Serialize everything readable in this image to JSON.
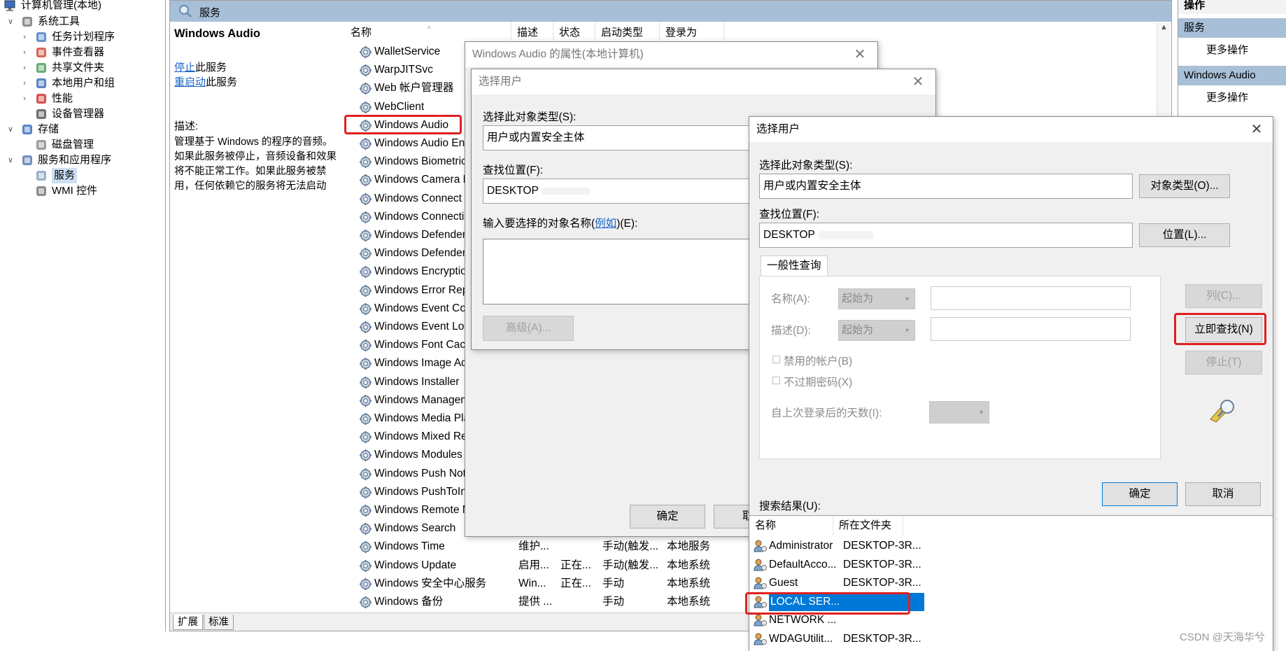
{
  "tree": {
    "root": "计算机管理(本地)",
    "items": [
      {
        "label": "系统工具",
        "level": 1,
        "expanded": true
      },
      {
        "label": "任务计划程序",
        "level": 2
      },
      {
        "label": "事件查看器",
        "level": 2
      },
      {
        "label": "共享文件夹",
        "level": 2
      },
      {
        "label": "本地用户和组",
        "level": 2
      },
      {
        "label": "性能",
        "level": 2
      },
      {
        "label": "设备管理器",
        "level": 2
      },
      {
        "label": "存储",
        "level": 1,
        "expanded": true
      },
      {
        "label": "磁盘管理",
        "level": 2
      },
      {
        "label": "服务和应用程序",
        "level": 1,
        "expanded": true
      },
      {
        "label": "服务",
        "level": 2,
        "selected": true
      },
      {
        "label": "WMI 控件",
        "level": 2
      }
    ]
  },
  "services_header": "服务",
  "description_pane": {
    "title": "Windows Audio",
    "stop_link": "停止",
    "stop_suffix": "此服务",
    "restart_link": "重启动",
    "restart_suffix": "此服务",
    "desc_label": "描述:",
    "desc_lines": [
      "管理基于 Windows 的程序的音频。",
      "如果此服务被停止，音频设备和效果",
      "将不能正常工作。如果此服务被禁",
      "用，任何依赖它的服务将无法启动"
    ]
  },
  "columns": {
    "name": "名称",
    "desc": "描述",
    "status": "状态",
    "startup": "启动类型",
    "logon": "登录为"
  },
  "services": [
    {
      "name": "WalletService"
    },
    {
      "name": "WarpJITSvc"
    },
    {
      "name": "Web 帐户管理器"
    },
    {
      "name": "WebClient"
    },
    {
      "name": "Windows Audio",
      "highlighted": true
    },
    {
      "name": "Windows Audio End"
    },
    {
      "name": "Windows Biometric"
    },
    {
      "name": "Windows Camera F"
    },
    {
      "name": "Windows Connect N"
    },
    {
      "name": "Windows Connectio"
    },
    {
      "name": "Windows Defender"
    },
    {
      "name": "Windows Defender"
    },
    {
      "name": "Windows Encryptio"
    },
    {
      "name": "Windows Error Rep"
    },
    {
      "name": "Windows Event Col"
    },
    {
      "name": "Windows Event Log"
    },
    {
      "name": "Windows Font Cach"
    },
    {
      "name": "Windows Image Ac"
    },
    {
      "name": "Windows Installer"
    },
    {
      "name": "Windows Managem"
    },
    {
      "name": "Windows Media Pla"
    },
    {
      "name": "Windows Mixed Re"
    },
    {
      "name": "Windows Modules"
    },
    {
      "name": "Windows Push Not"
    },
    {
      "name": "Windows PushToIn"
    },
    {
      "name": "Windows Remote M"
    },
    {
      "name": "Windows Search"
    },
    {
      "name": "Windows Time",
      "desc": "维护...",
      "status": "",
      "startup": "手动(触发...",
      "logon": "本地服务"
    },
    {
      "name": "Windows Update",
      "desc": "启用...",
      "status": "正在...",
      "startup": "手动(触发...",
      "logon": "本地系统"
    },
    {
      "name": "Windows 安全中心服务",
      "desc": "Win...",
      "status": "正在...",
      "startup": "手动",
      "logon": "本地系统"
    },
    {
      "name": "Windows 备份",
      "desc": "提供 ...",
      "status": "",
      "startup": "手动",
      "logon": "本地系统"
    }
  ],
  "bottom_tabs": [
    "扩展",
    "标准"
  ],
  "actions": {
    "header": "操作",
    "section1": "服务",
    "more1": "更多操作",
    "section2": "Windows Audio",
    "more2": "更多操作"
  },
  "props_dialog": {
    "title": "Windows Audio 的属性(本地计算机)",
    "ok": "确定",
    "cancel_partial": "取"
  },
  "select_user_back": {
    "title": "选择用户",
    "object_type_label": "选择此对象类型(S):",
    "object_type_value": "用户或内置安全主体",
    "location_label": "查找位置(F):",
    "location_value": "DESKTOP",
    "enter_name_label_prefix": "输入要选择的对象名称(",
    "enter_name_link": "例如",
    "enter_name_label_suffix": ")(E):",
    "advanced_button": "高级(A)..."
  },
  "select_user_front": {
    "title": "选择用户",
    "object_type_label": "选择此对象类型(S):",
    "object_type_value": "用户或内置安全主体",
    "object_types_button": "对象类型(O)...",
    "location_label": "查找位置(F):",
    "location_value": "DESKTOP",
    "locations_button": "位置(L)...",
    "tab_general": "一般性查询",
    "name_label": "名称(A):",
    "name_op": "起始为",
    "desc_label": "描述(D):",
    "desc_op": "起始为",
    "disabled_accounts": "禁用的帐户(B)",
    "non_expiring": "不过期密码(X)",
    "days_since_logon": "自上次登录后的天数(I):",
    "columns_button": "列(C)...",
    "find_now_button": "立即查找(N)",
    "stop_button": "停止(T)",
    "ok_button": "确定",
    "cancel_button": "取消",
    "results_label": "搜索结果(U):",
    "results_columns": {
      "name": "名称",
      "folder": "所在文件夹"
    },
    "results": [
      {
        "name": "Administrator",
        "folder": "DESKTOP-3R..."
      },
      {
        "name": "DefaultAcco...",
        "folder": "DESKTOP-3R..."
      },
      {
        "name": "Guest",
        "folder": "DESKTOP-3R..."
      },
      {
        "name": "LOCAL SER...",
        "folder": "",
        "selected": true
      },
      {
        "name": "NETWORK ...",
        "folder": ""
      },
      {
        "name": "WDAGUtilit...",
        "folder": "DESKTOP-3R..."
      }
    ]
  },
  "watermark": "CSDN @天海华兮",
  "colors": {
    "highlight": "#e02020",
    "selection": "#0078d7",
    "header_blue": "#a8bfd8"
  }
}
